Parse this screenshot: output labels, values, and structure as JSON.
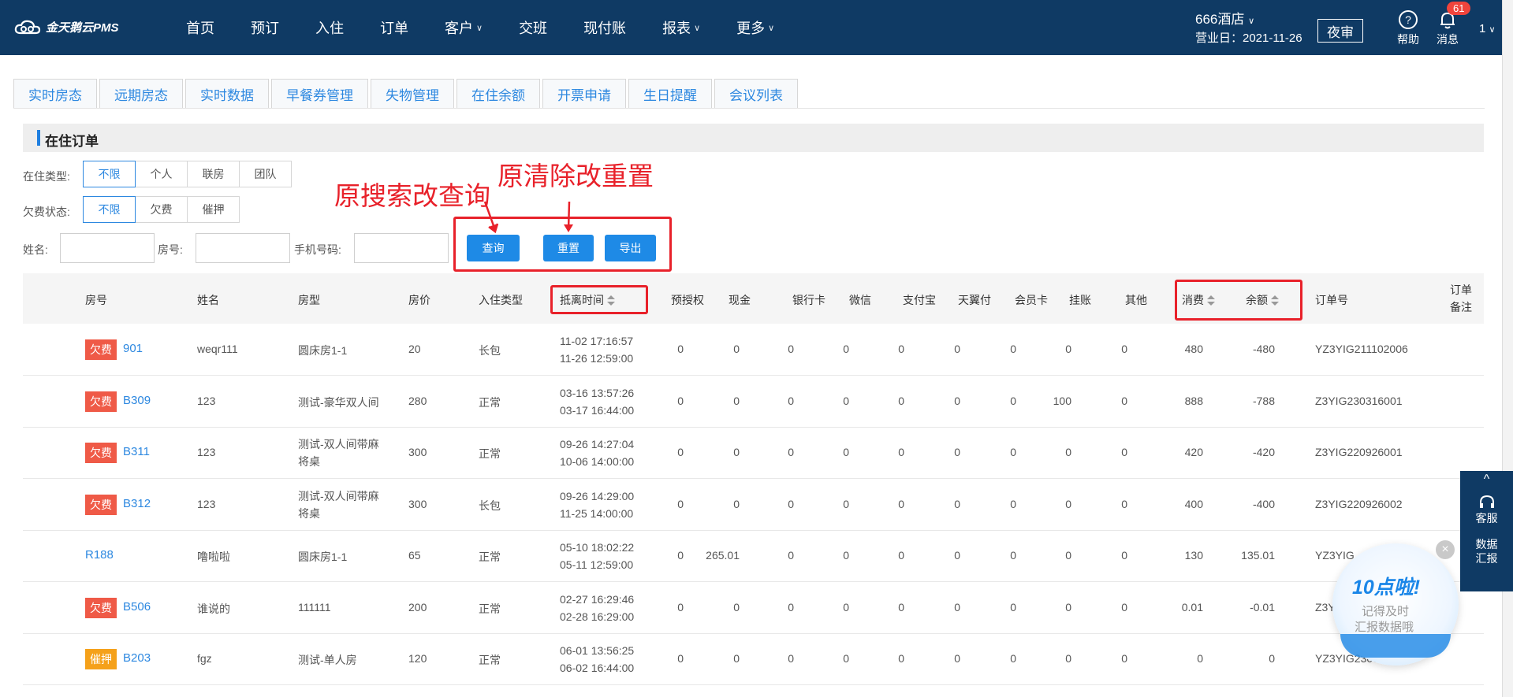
{
  "app": {
    "name": "金天鹅云PMS"
  },
  "nav": [
    {
      "label": "首页",
      "caret": false
    },
    {
      "label": "预订",
      "caret": false
    },
    {
      "label": "入住",
      "caret": false
    },
    {
      "label": "订单",
      "caret": false
    },
    {
      "label": "客户",
      "caret": true
    },
    {
      "label": "交班",
      "caret": false
    },
    {
      "label": "现付账",
      "caret": false
    },
    {
      "label": "报表",
      "caret": true
    },
    {
      "label": "更多",
      "caret": true
    }
  ],
  "hotel": {
    "name": "666酒店",
    "business_day": "营业日：2021-11-26"
  },
  "header": {
    "night_audit": "夜审",
    "help": "帮助",
    "messages": "消息",
    "message_count": "61",
    "user": "1"
  },
  "tabs": [
    "实时房态",
    "远期房态",
    "实时数据",
    "早餐券管理",
    "失物管理",
    "在住余额",
    "开票申请",
    "生日提醒",
    "会议列表"
  ],
  "section": {
    "title": "在住订单"
  },
  "filters": {
    "stay_type_label": "在住类型:",
    "stay_type_options": [
      "不限",
      "个人",
      "联房",
      "团队"
    ],
    "arrears_label": "欠费状态:",
    "arrears_options": [
      "不限",
      "欠费",
      "催押"
    ],
    "name_label": "姓名:",
    "room_label": "房号:",
    "phone_label": "手机号码:",
    "name_value": "",
    "room_value": "",
    "phone_value": ""
  },
  "buttons": {
    "query": "查询",
    "reset": "重置",
    "export": "导出"
  },
  "annotations": {
    "search_note": "原搜索改查询",
    "clear_note": "原清除改重置"
  },
  "table": {
    "headers": {
      "room": "房号",
      "name": "姓名",
      "room_type": "房型",
      "price": "房价",
      "checkin_type": "入住类型",
      "arrive_leave": "抵离时间",
      "preauth": "预授权",
      "cash": "现金",
      "bank_card": "银行卡",
      "wechat": "微信",
      "alipay": "支付宝",
      "tianyi": "天翼付",
      "member_card": "会员卡",
      "on_account": "挂账",
      "other": "其他",
      "consume": "消费",
      "balance": "余额",
      "order_no": "订单号",
      "order_note_1": "订单",
      "order_note_2": "备注"
    },
    "rows": [
      {
        "tag": "欠费",
        "tag_color": "#ef5a47",
        "room": "901",
        "name": "weqr111",
        "room_type_1": "圆床房1-1",
        "room_type_2": "",
        "price": "20",
        "checkin_type": "长包",
        "arrive": "11-02 17:16:57",
        "leave": "11-26 12:59:00",
        "preauth": "0",
        "cash": "0",
        "bank_card": "0",
        "wechat": "0",
        "alipay": "0",
        "tianyi": "0",
        "member_card": "0",
        "on_account": "0",
        "other": "0",
        "consume": "480",
        "balance": "-480",
        "order_no": "YZ3YIG211102006"
      },
      {
        "tag": "欠费",
        "tag_color": "#ef5a47",
        "room": "B309",
        "name": "123",
        "room_type_1": "测试-豪华双人间",
        "room_type_2": "",
        "price": "280",
        "checkin_type": "正常",
        "arrive": "03-16 13:57:26",
        "leave": "03-17 16:44:00",
        "preauth": "0",
        "cash": "0",
        "bank_card": "0",
        "wechat": "0",
        "alipay": "0",
        "tianyi": "0",
        "member_card": "0",
        "on_account": "100",
        "other": "0",
        "consume": "888",
        "balance": "-788",
        "order_no": "Z3YIG230316001"
      },
      {
        "tag": "欠费",
        "tag_color": "#ef5a47",
        "room": "B311",
        "name": "123",
        "room_type_1": "测试-双人间带麻",
        "room_type_2": "将桌",
        "price": "300",
        "checkin_type": "正常",
        "arrive": "09-26 14:27:04",
        "leave": "10-06 14:00:00",
        "preauth": "0",
        "cash": "0",
        "bank_card": "0",
        "wechat": "0",
        "alipay": "0",
        "tianyi": "0",
        "member_card": "0",
        "on_account": "0",
        "other": "0",
        "consume": "420",
        "balance": "-420",
        "order_no": "Z3YIG220926001"
      },
      {
        "tag": "欠费",
        "tag_color": "#ef5a47",
        "room": "B312",
        "name": "123",
        "room_type_1": "测试-双人间带麻",
        "room_type_2": "将桌",
        "price": "300",
        "checkin_type": "长包",
        "arrive": "09-26 14:29:00",
        "leave": "11-25 14:00:00",
        "preauth": "0",
        "cash": "0",
        "bank_card": "0",
        "wechat": "0",
        "alipay": "0",
        "tianyi": "0",
        "member_card": "0",
        "on_account": "0",
        "other": "0",
        "consume": "400",
        "balance": "-400",
        "order_no": "Z3YIG220926002"
      },
      {
        "tag": "",
        "tag_color": "",
        "room": "R188",
        "name": "噜啦啦",
        "room_type_1": "圆床房1-1",
        "room_type_2": "",
        "price": "65",
        "checkin_type": "正常",
        "arrive": "05-10 18:02:22",
        "leave": "05-11 12:59:00",
        "preauth": "0",
        "cash": "265.01",
        "bank_card": "0",
        "wechat": "0",
        "alipay": "0",
        "tianyi": "0",
        "member_card": "0",
        "on_account": "0",
        "other": "0",
        "consume": "130",
        "balance": "135.01",
        "order_no": "YZ3YIG"
      },
      {
        "tag": "欠费",
        "tag_color": "#ef5a47",
        "room": "B506",
        "name": "谁说的",
        "room_type_1": "111111",
        "room_type_2": "",
        "price": "200",
        "checkin_type": "正常",
        "arrive": "02-27 16:29:46",
        "leave": "02-28 16:29:00",
        "preauth": "0",
        "cash": "0",
        "bank_card": "0",
        "wechat": "0",
        "alipay": "0",
        "tianyi": "0",
        "member_card": "0",
        "on_account": "0",
        "other": "0",
        "consume": "0.01",
        "balance": "-0.01",
        "order_no": "Z3Y"
      },
      {
        "tag": "催押",
        "tag_color": "#f5a11a",
        "room": "B203",
        "name": "fgz",
        "room_type_1": "测试-单人房",
        "room_type_2": "",
        "price": "120",
        "checkin_type": "正常",
        "arrive": "06-01 13:56:25",
        "leave": "06-02 16:44:00",
        "preauth": "0",
        "cash": "0",
        "bank_card": "0",
        "wechat": "0",
        "alipay": "0",
        "tianyi": "0",
        "member_card": "0",
        "on_account": "0",
        "other": "0",
        "consume": "0",
        "balance": "0",
        "order_no": "YZ3YIG2306"
      }
    ]
  },
  "side_panel": {
    "service": "客服",
    "report_1": "数据",
    "report_2": "汇报"
  },
  "float_ad": {
    "title": "10点啦!",
    "line1": "记得及时",
    "line2": "汇报数据哦"
  },
  "colors": {
    "header_bg": "#0f3a64",
    "accent": "#1e8ae6",
    "annotation": "#e8212a"
  }
}
